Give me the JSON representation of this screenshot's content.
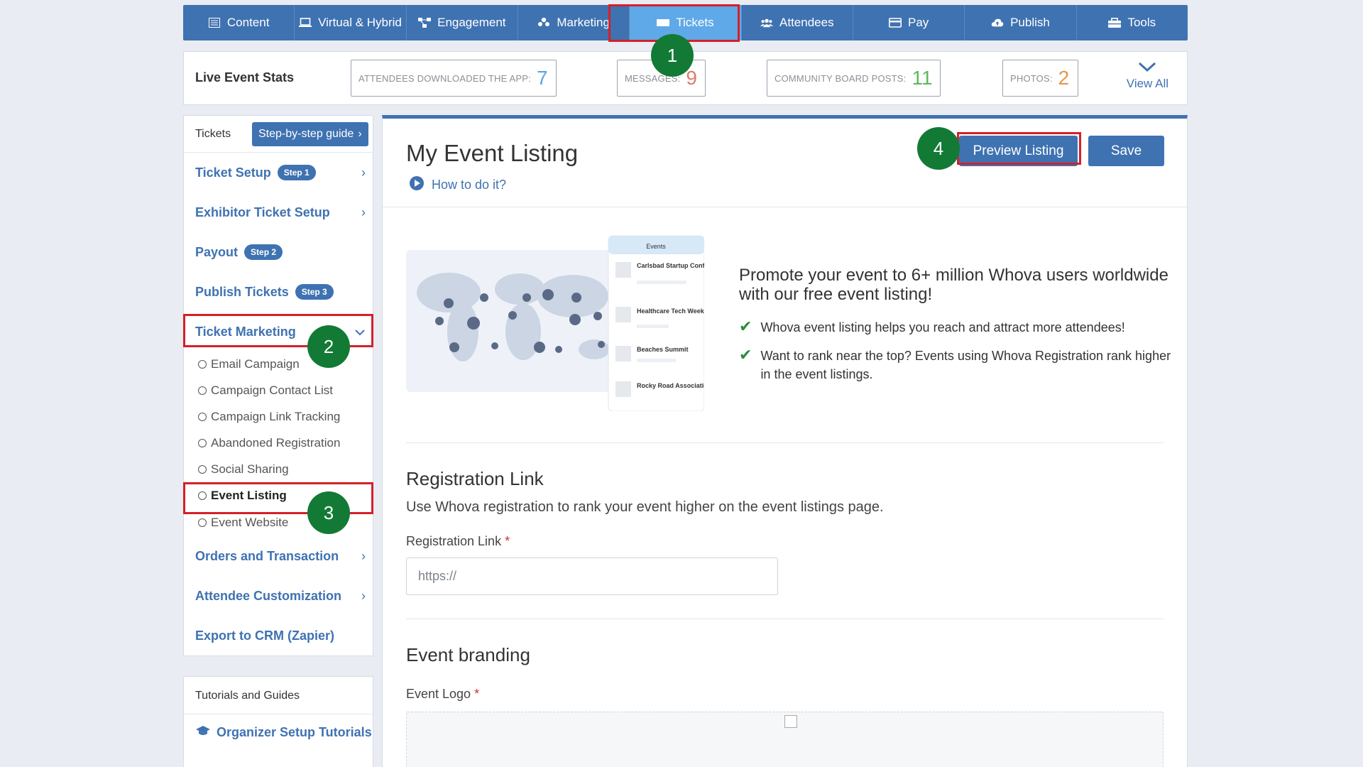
{
  "nav": {
    "tabs": [
      {
        "label": "Content",
        "icon": "list-icon"
      },
      {
        "label": "Virtual & Hybrid",
        "icon": "laptop-icon"
      },
      {
        "label": "Engagement",
        "icon": "network-icon"
      },
      {
        "label": "Marketing",
        "icon": "people-group-icon"
      },
      {
        "label": "Tickets",
        "icon": "ticket-icon",
        "active": true
      },
      {
        "label": "Attendees",
        "icon": "users-icon"
      },
      {
        "label": "Pay",
        "icon": "credit-card-icon"
      },
      {
        "label": "Publish",
        "icon": "cloud-upload-icon"
      },
      {
        "label": "Tools",
        "icon": "toolbox-icon"
      }
    ]
  },
  "stats": {
    "title": "Live Event Stats",
    "items": [
      {
        "label": "Attendees downloaded the app:",
        "value": "7",
        "color": "#5ba4e0"
      },
      {
        "label": "Messages:",
        "value": "9",
        "color": "#e07a6a"
      },
      {
        "label": "Community board posts:",
        "value": "11",
        "color": "#5cb85c"
      },
      {
        "label": "Photos:",
        "value": "2",
        "color": "#e8954a"
      }
    ],
    "view_all": "View All"
  },
  "sidebar": {
    "head": "Tickets",
    "guide_button": "Step-by-step guide",
    "items": [
      {
        "label": "Ticket Setup",
        "step": "Step 1"
      },
      {
        "label": "Exhibitor Ticket Setup"
      },
      {
        "label": "Payout",
        "step": "Step 2"
      },
      {
        "label": "Publish Tickets",
        "step": "Step 3"
      },
      {
        "label": "Ticket Marketing"
      }
    ],
    "subitems": [
      "Email Campaign",
      "Campaign Contact List",
      "Campaign Link Tracking",
      "Abandoned Registration",
      "Social Sharing",
      "Event Listing",
      "Event Website"
    ],
    "items_after": [
      {
        "label": "Orders and Transaction"
      },
      {
        "label": "Attendee Customization"
      },
      {
        "label": "Export to CRM (Zapier)"
      }
    ]
  },
  "tutorials": {
    "title": "Tutorials and Guides",
    "link": "Organizer Setup Tutorials"
  },
  "main": {
    "title": "My Event Listing",
    "how_to": "How to do it?",
    "preview_button": "Preview Listing",
    "save_button": "Save",
    "promo": {
      "headline": "Promote your event to 6+ million Whova users worldwide with our free event listing!",
      "points": [
        "Whova event listing helps you reach and attract more attendees!",
        "Want to rank near the top? Events using Whova Registration rank higher in the event listings."
      ],
      "illustration": {
        "panel_title": "Events",
        "events": [
          "Carlsbad Startup Conference",
          "Healthcare Tech Week",
          "Beaches Summit",
          "Rocky Road Association"
        ]
      }
    },
    "registration": {
      "title": "Registration Link",
      "desc": "Use Whova registration to rank your event higher on the event listings page.",
      "field_label": "Registration Link",
      "required_mark": "*",
      "placeholder": "https://"
    },
    "branding": {
      "title": "Event branding",
      "logo_label": "Event Logo",
      "required_mark": "*"
    }
  },
  "annotations": {
    "markers": [
      "1",
      "2",
      "3",
      "4"
    ],
    "highlight_color": "#d42028",
    "marker_color": "#127a35"
  }
}
